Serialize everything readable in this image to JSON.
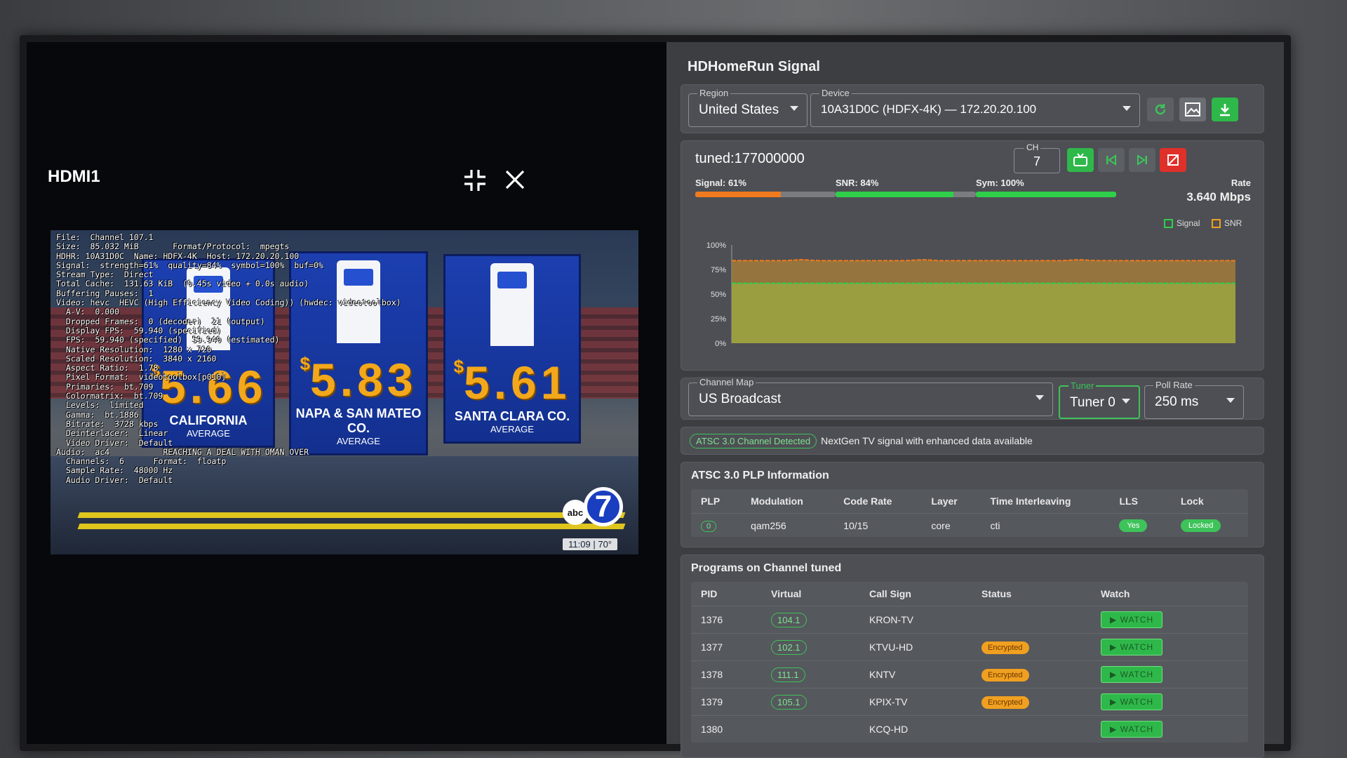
{
  "source": {
    "label": "HDMI1"
  },
  "video_osd": {
    "lines": [
      "File:  Channel 107.1",
      "Size:  85.032 MiB       Format/Protocol:  mpegts",
      "HDHR: 10A31D0C  Name: HDFX-4K  Host: 172.20.20.100",
      "Signal:  strength=61%  quality=84%  symbol=100%  buf=0%",
      "Stream Type:  Direct",
      "Total Cache:  131.63 KiB  (0.45s video + 0.0s audio)",
      "Buffering Pauses:  1",
      "Video: hevc  HEVC (High Efficiency Video Coding)) (hwdec: videotoolbox)",
      "  A-V:  0.000",
      "  Dropped Frames:  0 (decoder)  21 (output)",
      "  Display FPS:  59.940 (specified)",
      "  FPS:  59.940 (specified)  59.940 (estimated)",
      "  Native Resolution:  1280 x 720",
      "  Scaled Resolution:  3840 x 2160",
      "  Aspect Ratio:  1.78",
      "  Pixel Format:  videotoolbox[p010]",
      "  Primaries:  bt.709",
      "  Colormatrix:  bt.709",
      "  Levels:  limited",
      "  Gamma:  bt.1886",
      "  Bitrate:  3728 kbps",
      "  Deinterlacer:  Linear",
      "  Video Driver:  Default",
      "Audio:  ac4           REACHING A DEAL WITH OMAN OVER",
      "  Channels:  6      Format:  floatp",
      "  Sample Rate:  48000 Hz",
      "  Audio Driver:  Default"
    ],
    "signs": [
      {
        "price": "5.66",
        "place": "CALIFORNIA",
        "avg": "AVERAGE"
      },
      {
        "price": "5.83",
        "place": "NAPA & SAN MATEO CO.",
        "avg": "AVERAGE"
      },
      {
        "price": "5.61",
        "place": "SANTA CLARA CO.",
        "avg": "AVERAGE"
      }
    ],
    "dollar": "$",
    "logo_abc": "abc",
    "logo_seven": "7",
    "time_bug": "11:09 | 70°"
  },
  "panel": {
    "title": "HDHomeRun Signal",
    "region": {
      "label": "Region",
      "value": "United States"
    },
    "device": {
      "label": "Device",
      "value": "10A31D0C (HDFX-4K) — 172.20.20.100"
    },
    "tuned": "tuned:177000000",
    "ch": {
      "label": "CH",
      "value": "7"
    },
    "signal": {
      "label": "Signal: 61%",
      "value": 61,
      "color": "#f07a1e"
    },
    "snr": {
      "label": "SNR: 84%",
      "value": 84,
      "color": "#2fcf4a"
    },
    "sym": {
      "label": "Sym: 100%",
      "value": 100,
      "color": "#2fcf4a"
    },
    "rate": {
      "label": "Rate",
      "value": "3.640 Mbps"
    },
    "legend": {
      "signal": "Signal",
      "snr": "SNR",
      "signal_color": "#2fcf4a",
      "snr_color": "#f0a020"
    },
    "channel_map": {
      "label": "Channel Map",
      "value": "US Broadcast"
    },
    "tuner": {
      "label": "Tuner",
      "value": "Tuner 0"
    },
    "poll_rate": {
      "label": "Poll Rate",
      "value": "250 ms"
    },
    "atsc_badge": "ATSC 3.0 Channel Detected",
    "atsc_note": "NextGen TV signal with enhanced data available"
  },
  "chart_data": {
    "type": "area",
    "ylim": [
      0,
      100
    ],
    "y_ticks": [
      "100%",
      "75%",
      "50%",
      "25%",
      "0%"
    ],
    "y_tick_values": [
      100,
      75,
      50,
      25,
      0
    ],
    "series": [
      {
        "name": "Signal",
        "color": "#2fcf4a",
        "values": [
          61,
          61,
          61,
          61,
          61,
          61,
          61,
          61,
          61,
          61,
          61,
          61,
          61,
          61,
          61,
          61,
          61,
          61,
          61,
          61,
          61,
          61,
          61,
          61,
          61,
          61,
          61,
          61,
          61,
          61
        ]
      },
      {
        "name": "SNR",
        "color": "#f07a1e",
        "values": [
          84,
          84,
          84,
          84,
          85,
          84,
          84,
          84,
          84,
          84,
          84,
          85,
          84,
          84,
          84,
          84,
          84,
          84,
          84,
          84,
          85,
          84,
          84,
          84,
          84,
          84,
          84,
          84,
          84,
          84
        ]
      }
    ],
    "grid": false,
    "legend": "top-right"
  },
  "plp": {
    "title": "ATSC 3.0 PLP Information",
    "headers": [
      "PLP",
      "Modulation",
      "Code Rate",
      "Layer",
      "Time Interleaving",
      "LLS",
      "Lock"
    ],
    "rows": [
      {
        "plp": "0",
        "modulation": "qam256",
        "code_rate": "10/15",
        "layer": "core",
        "ti": "cti",
        "lls": "Yes",
        "lock": "Locked"
      }
    ]
  },
  "programs": {
    "title": "Programs on Channel tuned",
    "headers": [
      "PID",
      "Virtual",
      "Call Sign",
      "Status",
      "Watch"
    ],
    "watch_label": "▶  WATCH",
    "rows": [
      {
        "pid": "1376",
        "virtual": "104.1",
        "callsign": "KRON-TV",
        "status": ""
      },
      {
        "pid": "1377",
        "virtual": "102.1",
        "callsign": "KTVU-HD",
        "status": "Encrypted"
      },
      {
        "pid": "1378",
        "virtual": "111.1",
        "callsign": "KNTV",
        "status": "Encrypted"
      },
      {
        "pid": "1379",
        "virtual": "105.1",
        "callsign": "KPIX-TV",
        "status": "Encrypted"
      },
      {
        "pid": "1380",
        "virtual": "",
        "callsign": "KCQ-HD",
        "status": ""
      }
    ]
  }
}
